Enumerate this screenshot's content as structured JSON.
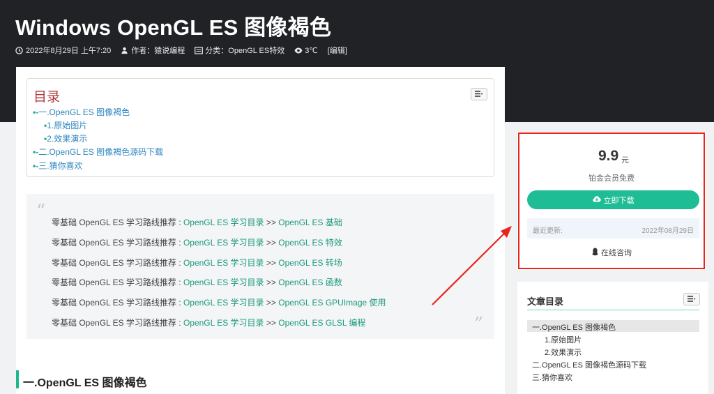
{
  "header": {
    "title": "Windows OpenGL ES 图像褐色",
    "meta": {
      "date": "2022年8月29日 上午7:20",
      "author": "作者：猿说编程",
      "category": "分类：OpenGL ES特效",
      "views": "3℃",
      "edit": "[编辑]"
    }
  },
  "toc": {
    "title": "目录",
    "items": [
      {
        "dash": "•-",
        "label": "一.OpenGL ES 图像褐色"
      },
      {
        "dash": "•",
        "label": "1.原始图片"
      },
      {
        "dash": "•",
        "label": "2.效果演示"
      },
      {
        "dash": "•-",
        "label": "二.OpenGL ES 图像褐色源码下载"
      },
      {
        "dash": "•-",
        "label": "三.猜你喜欢"
      }
    ]
  },
  "quote": {
    "open": "“",
    "close": "”",
    "lines": [
      {
        "prefix": "零基础 OpenGL ES 学习路线推荐 : ",
        "link1": "OpenGL ES 学习目录",
        "sep": " >> ",
        "link2": "OpenGL ES 基础"
      },
      {
        "prefix": "零基础 OpenGL ES 学习路线推荐 : ",
        "link1": "OpenGL ES 学习目录",
        "sep": "  >> ",
        "link2": "OpenGL ES 特效"
      },
      {
        "prefix": "零基础 OpenGL ES 学习路线推荐 : ",
        "link1": "OpenGL ES 学习目录",
        "sep": "  >> ",
        "link2": "OpenGL ES 转场"
      },
      {
        "prefix": "零基础 OpenGL ES 学习路线推荐 :  ",
        "link1": "OpenGL ES 学习目录",
        "sep": " >> ",
        "link2": "OpenGL ES 函数"
      },
      {
        "prefix": "零基础 OpenGL ES 学习路线推荐 :  ",
        "link1": "OpenGL ES 学习目录",
        "sep": " >> ",
        "link2": "OpenGL ES GPUImage 使用"
      },
      {
        "prefix": "零基础 OpenGL ES 学习路线推荐 :  ",
        "link1": "OpenGL ES 学习目录",
        "sep": " >> ",
        "link2": "OpenGL ES GLSL 编程"
      }
    ]
  },
  "section": {
    "title": "一.OpenGL ES 图像褐色"
  },
  "download_card": {
    "price": "9.9",
    "unit": "元",
    "member_text": "铂金会员免费",
    "button": "立即下载",
    "update_label": "最近更新:",
    "update_date": "2022年08月29日",
    "consult": "在线咨询"
  },
  "article_toc": {
    "title": "文章目录",
    "items": [
      "一.OpenGL ES 图像褐色",
      "1.原始图片",
      "2.效果演示",
      "二.OpenGL ES 图像褐色源码下载",
      "三.猜你喜欢"
    ]
  },
  "colors": {
    "accent": "#1fbd95",
    "highlight_border": "#e8251c",
    "link": "#1c9a7f",
    "toc_title": "#b0343b"
  }
}
